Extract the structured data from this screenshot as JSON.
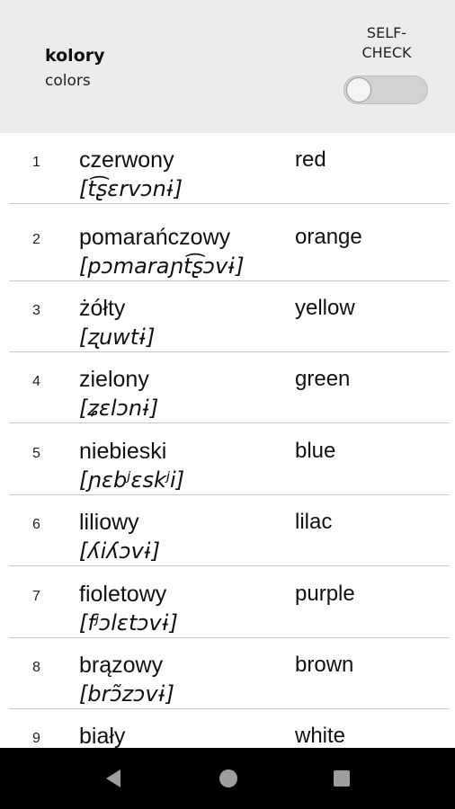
{
  "header": {
    "title": "kolory",
    "subtitle": "colors",
    "self_check_label": "SELF-\nCHECK",
    "self_check_enabled": false
  },
  "words": [
    {
      "num": "1",
      "word": "czerwony",
      "pron": "[t͡ʂɛrvɔnɨ]",
      "translation": "red"
    },
    {
      "num": "2",
      "word": "pomarańczowy",
      "pron": "[pɔmaraɲt͡ʂɔvɨ]",
      "translation": "orange"
    },
    {
      "num": "3",
      "word": "żółty",
      "pron": "[ʐuwtɨ]",
      "translation": "yellow"
    },
    {
      "num": "4",
      "word": "zielony",
      "pron": "[ʑɛlɔnɨ]",
      "translation": "green"
    },
    {
      "num": "5",
      "word": "niebieski",
      "pron": "[ɲɛbʲɛskʲi]",
      "translation": "blue"
    },
    {
      "num": "6",
      "word": "liliowy",
      "pron": "[ʎiʎɔvɨ]",
      "translation": "lilac"
    },
    {
      "num": "7",
      "word": "fioletowy",
      "pron": "[fʲɔlɛtɔvɨ]",
      "translation": "purple"
    },
    {
      "num": "8",
      "word": "brązowy",
      "pron": "[brɔ̃zɔvɨ]",
      "translation": "brown"
    },
    {
      "num": "9",
      "word": "biały",
      "pron": "",
      "translation": "white"
    }
  ],
  "navbar": {
    "back_icon": "back-triangle-icon",
    "home_icon": "home-circle-icon",
    "recent_icon": "recent-square-icon"
  }
}
